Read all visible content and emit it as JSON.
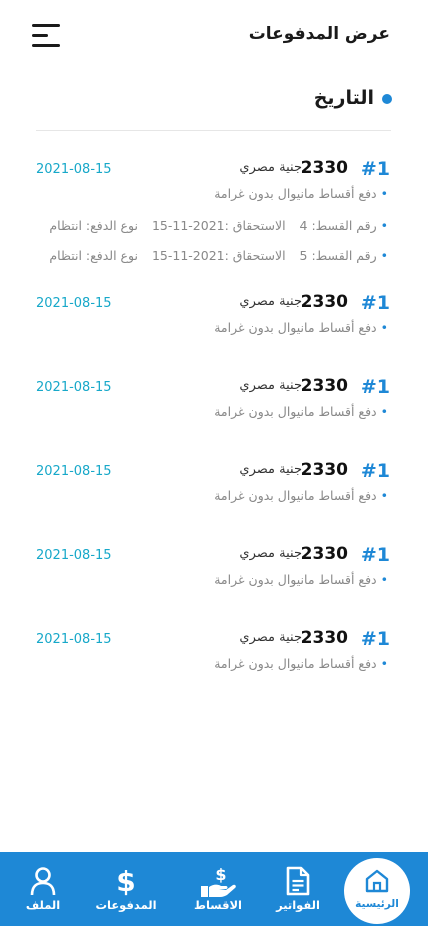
{
  "header": {
    "title": "عرض المدفوعات",
    "menu_icon": "hamburger-menu-icon"
  },
  "section": {
    "title": "التاريخ"
  },
  "payments": [
    {
      "number": "#1",
      "amount": "2330",
      "currency": "جنية مصري",
      "date": "2021-08-15",
      "description": "دفع أقساط مانيوال بدون غرامة",
      "details": [
        {
          "installment": "رقم القسط: 4",
          "due": "الاستحقاق :2021-11-15",
          "type": "نوع الدفع: انتظام"
        },
        {
          "installment": "رقم القسط: 5",
          "due": "الاستحقاق :2021-11-15",
          "type": "نوع الدفع: انتظام"
        }
      ]
    },
    {
      "number": "#1",
      "amount": "2330",
      "currency": "جنية مصري",
      "date": "2021-08-15",
      "description": "دفع أقساط مانيوال بدون غرامة"
    },
    {
      "number": "#1",
      "amount": "2330",
      "currency": "جنية مصري",
      "date": "2021-08-15",
      "description": "دفع أقساط مانيوال بدون غرامة"
    },
    {
      "number": "#1",
      "amount": "2330",
      "currency": "جنية مصري",
      "date": "2021-08-15",
      "description": "دفع أقساط مانيوال بدون غرامة"
    },
    {
      "number": "#1",
      "amount": "2330",
      "currency": "جنية مصري",
      "date": "2021-08-15",
      "description": "دفع أقساط مانيوال بدون غرامة"
    },
    {
      "number": "#1",
      "amount": "2330",
      "currency": "جنية مصري",
      "date": "2021-08-15",
      "description": "دفع أقساط مانيوال بدون غرامة"
    }
  ],
  "bottom_nav": {
    "home": "الرئيسية",
    "invoices": "الفواتير",
    "installments": "الاقساط",
    "payments": "المدفوعات",
    "profile": "الملف"
  },
  "colors": {
    "accent": "#1e88d6",
    "date": "#17a8c9"
  }
}
